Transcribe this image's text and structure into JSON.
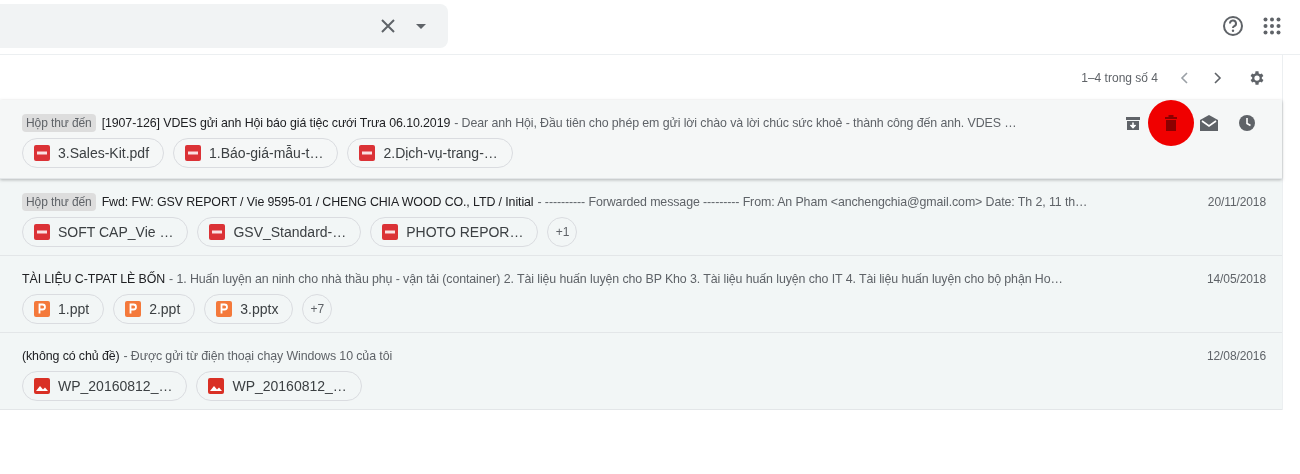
{
  "pagination": {
    "range": "1–4 trong số 4"
  },
  "emails": [
    {
      "label": "Hộp thư đến",
      "subject": "[1907-126] VDES gửi anh Hội báo giá tiệc cưới Trưa 06.10.2019",
      "snippet": "- Dear anh Hội, Đầu tiên cho phép em gửi lời chào và lời chúc sức khoẻ - thành công đến anh. VDES …",
      "hovered": true,
      "attachments": [
        {
          "kind": "pdf",
          "name": "3.Sales-Kit.pdf"
        },
        {
          "kind": "pdf",
          "name": "1.Báo-giá-mẫu-t…"
        },
        {
          "kind": "pdf",
          "name": "2.Dịch-vụ-trang-…"
        }
      ]
    },
    {
      "label": "Hộp thư đến",
      "subject": "Fwd: FW: GSV REPORT / Vie 9595-01 / CHENG CHIA WOOD CO., LTD / Initial",
      "snippet": "- ---------- Forwarded message --------- From: An Pham <anchengchia@gmail.com> Date: Th 2, 11 th…",
      "date": "20/11/2018",
      "hovered": false,
      "attachments": [
        {
          "kind": "pdf",
          "name": "SOFT CAP_Vie …"
        },
        {
          "kind": "pdf",
          "name": "GSV_Standard-…"
        },
        {
          "kind": "pdf",
          "name": "PHOTO REPOR…"
        }
      ],
      "more": "+1"
    },
    {
      "subject": "TÀI LIỆU C-TPAT LÈ BỐN",
      "snippet": "- 1. Huấn luyện an ninh cho nhà thầu phụ - vận tải (container) 2. Tài liệu huấn luyện cho BP Kho 3. Tài liệu huấn luyện cho IT 4. Tài liệu huấn luyện cho bộ phận Ho…",
      "date": "14/05/2018",
      "hovered": false,
      "attachments": [
        {
          "kind": "ppt",
          "name": "1.ppt"
        },
        {
          "kind": "ppt",
          "name": "2.ppt"
        },
        {
          "kind": "ppt",
          "name": "3.pptx"
        }
      ],
      "more": "+7"
    },
    {
      "subject": "(không có chủ đề)",
      "snippet": "- Được gửi từ điện thoại chạy Windows 10 của tôi",
      "date": "12/08/2016",
      "hovered": false,
      "attachments": [
        {
          "kind": "image",
          "name": "WP_20160812_…"
        },
        {
          "kind": "image",
          "name": "WP_20160812_…"
        }
      ]
    }
  ]
}
